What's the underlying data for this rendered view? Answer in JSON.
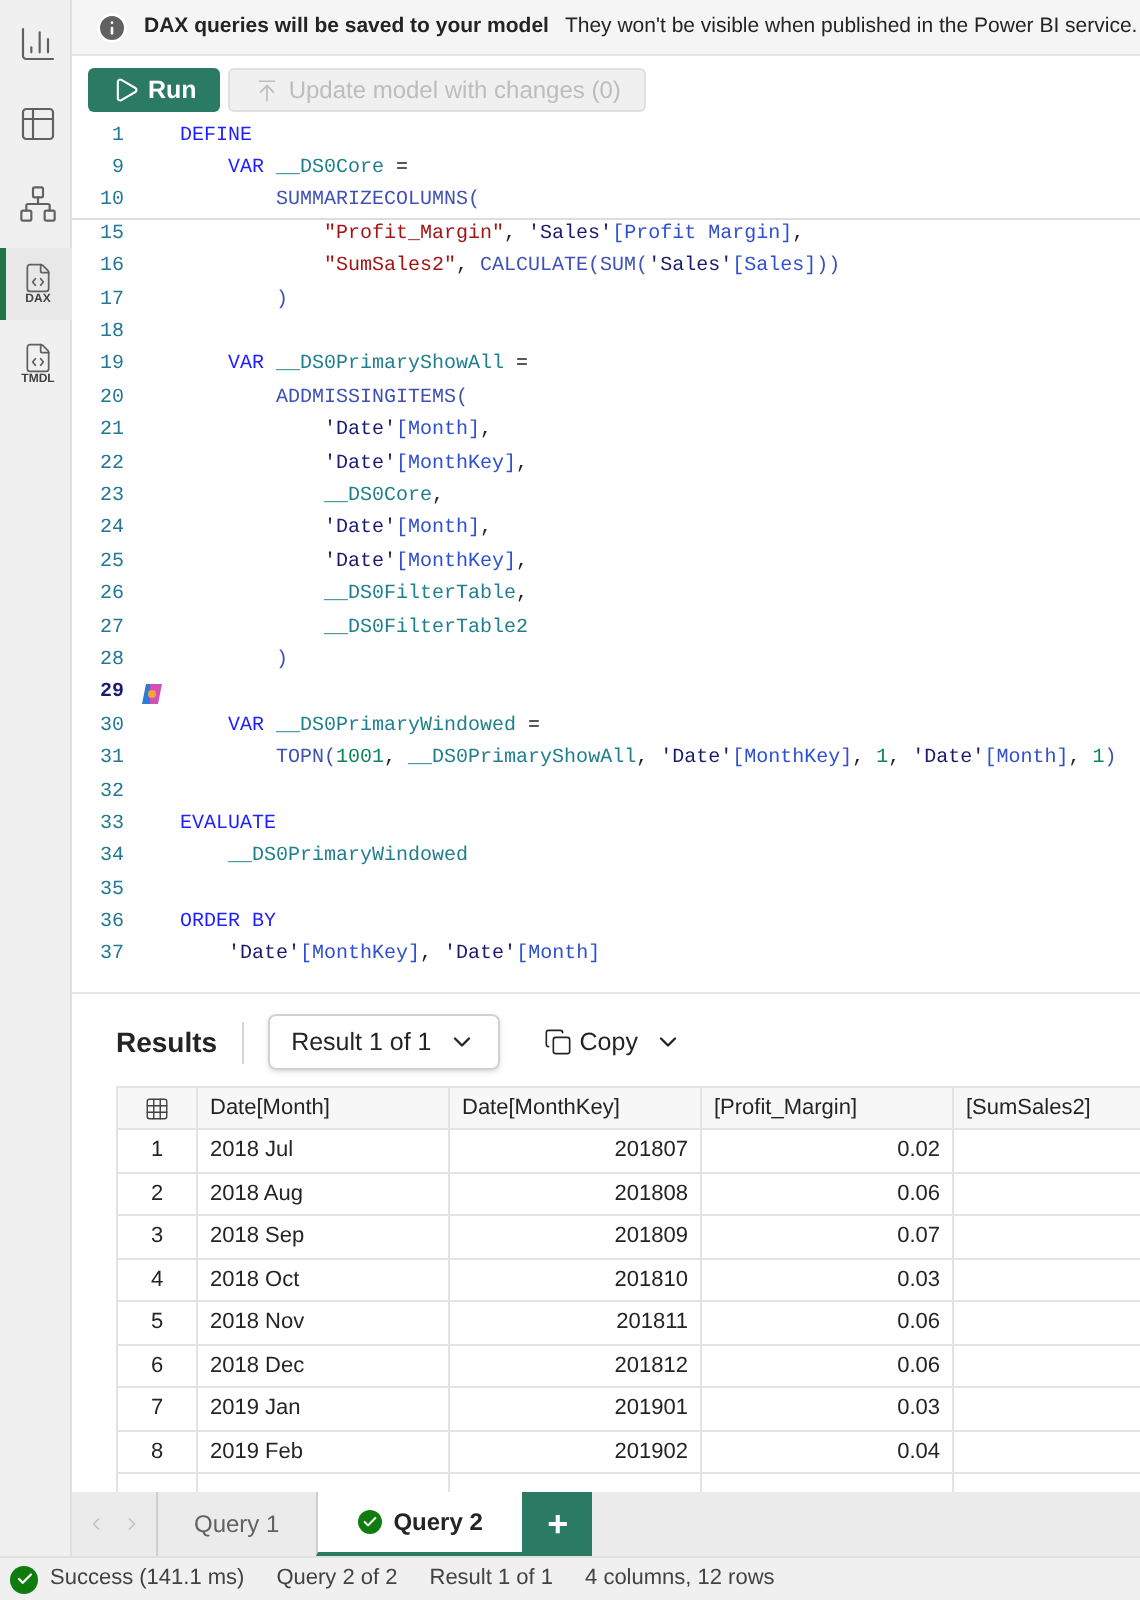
{
  "sidebar": {
    "items": [
      {
        "kind": "report",
        "selected": false
      },
      {
        "kind": "table",
        "selected": false
      },
      {
        "kind": "model",
        "selected": false
      },
      {
        "kind": "dax",
        "label": "DAX",
        "selected": true
      },
      {
        "kind": "tmdl",
        "label": "TMDL",
        "selected": false
      }
    ]
  },
  "banner": {
    "title": "DAX queries will be saved to your model",
    "message": "They won't be visible when published in the Power BI service."
  },
  "toolbar": {
    "run": "Run",
    "update": "Update model with changes (0)",
    "update_disabled": true
  },
  "editor": {
    "lines": [
      {
        "number": "1",
        "current": false,
        "tokens": [
          {
            "kind": "keyword",
            "text": "DEFINE"
          }
        ]
      },
      {
        "number": "9",
        "current": false,
        "tokens": [
          {
            "kind": "keyword",
            "text": "    VAR"
          },
          {
            "kind": "variable",
            "text": " __DS0Core"
          },
          {
            "kind": "plain",
            "text": " ="
          }
        ]
      },
      {
        "number": "10",
        "current": false,
        "tokens": [
          {
            "kind": "function",
            "text": "        SUMMARIZECOLUMNS("
          }
        ]
      },
      {
        "number": "15",
        "current": false,
        "tokens": [
          {
            "kind": "string",
            "text": "            \"Profit_Margin\""
          },
          {
            "kind": "plain",
            "text": ","
          },
          {
            "kind": "table",
            "text": " 'Sales'"
          },
          {
            "kind": "column",
            "text": "[Profit Margin]"
          },
          {
            "kind": "plain",
            "text": ","
          }
        ]
      },
      {
        "number": "16",
        "current": false,
        "tokens": [
          {
            "kind": "string",
            "text": "            \"SumSales2\""
          },
          {
            "kind": "plain",
            "text": ","
          },
          {
            "kind": "function",
            "text": " CALCULATE(SUM("
          },
          {
            "kind": "table",
            "text": "'Sales'"
          },
          {
            "kind": "column",
            "text": "[Sales]"
          },
          {
            "kind": "function",
            "text": "))"
          }
        ]
      },
      {
        "number": "17",
        "current": false,
        "tokens": [
          {
            "kind": "function",
            "text": "        )"
          }
        ]
      },
      {
        "number": "18",
        "current": false
      },
      {
        "number": "19",
        "current": false,
        "tokens": [
          {
            "kind": "keyword",
            "text": "    VAR"
          },
          {
            "kind": "variable",
            "text": " __DS0PrimaryShowAll"
          },
          {
            "kind": "plain",
            "text": " ="
          }
        ]
      },
      {
        "number": "20",
        "current": false,
        "tokens": [
          {
            "kind": "function",
            "text": "        ADDMISSINGITEMS("
          }
        ]
      },
      {
        "number": "21",
        "current": false,
        "tokens": [
          {
            "kind": "table",
            "text": "            'Date'"
          },
          {
            "kind": "column",
            "text": "[Month]"
          },
          {
            "kind": "plain",
            "text": ","
          }
        ]
      },
      {
        "number": "22",
        "current": false,
        "tokens": [
          {
            "kind": "table",
            "text": "            'Date'"
          },
          {
            "kind": "column",
            "text": "[MonthKey]"
          },
          {
            "kind": "plain",
            "text": ","
          }
        ]
      },
      {
        "number": "23",
        "current": false,
        "tokens": [
          {
            "kind": "variable",
            "text": "            __DS0Core"
          },
          {
            "kind": "plain",
            "text": ","
          }
        ]
      },
      {
        "number": "24",
        "current": false,
        "tokens": [
          {
            "kind": "table",
            "text": "            'Date'"
          },
          {
            "kind": "column",
            "text": "[Month]"
          },
          {
            "kind": "plain",
            "text": ","
          }
        ]
      },
      {
        "number": "25",
        "current": false,
        "tokens": [
          {
            "kind": "table",
            "text": "            'Date'"
          },
          {
            "kind": "column",
            "text": "[MonthKey]"
          },
          {
            "kind": "plain",
            "text": ","
          }
        ]
      },
      {
        "number": "26",
        "current": false,
        "tokens": [
          {
            "kind": "variable",
            "text": "            __DS0FilterTable"
          },
          {
            "kind": "plain",
            "text": ","
          }
        ]
      },
      {
        "number": "27",
        "current": false,
        "tokens": [
          {
            "kind": "variable",
            "text": "            __DS0FilterTable2"
          }
        ]
      },
      {
        "number": "28",
        "current": false,
        "tokens": [
          {
            "kind": "function",
            "text": "        )"
          }
        ]
      },
      {
        "number": "29",
        "current": true
      },
      {
        "number": "30",
        "current": false,
        "tokens": [
          {
            "kind": "keyword",
            "text": "    VAR"
          },
          {
            "kind": "variable",
            "text": " __DS0PrimaryWindowed"
          },
          {
            "kind": "plain",
            "text": " ="
          }
        ]
      },
      {
        "number": "31",
        "current": false,
        "tokens": [
          {
            "kind": "function",
            "text": "        TOPN("
          },
          {
            "kind": "number",
            "text": "1001"
          },
          {
            "kind": "plain",
            "text": ","
          },
          {
            "kind": "variable",
            "text": " __DS0PrimaryShowAll"
          },
          {
            "kind": "plain",
            "text": ","
          },
          {
            "kind": "table",
            "text": " 'Date'"
          },
          {
            "kind": "column",
            "text": "[MonthKey]"
          },
          {
            "kind": "plain",
            "text": ","
          },
          {
            "kind": "number",
            "text": " 1"
          },
          {
            "kind": "plain",
            "text": ","
          },
          {
            "kind": "table",
            "text": " 'Date'"
          },
          {
            "kind": "column",
            "text": "[Month]"
          },
          {
            "kind": "plain",
            "text": ","
          },
          {
            "kind": "number",
            "text": " 1"
          },
          {
            "kind": "function",
            "text": ")"
          }
        ]
      },
      {
        "number": "32",
        "current": false
      },
      {
        "number": "33",
        "current": false,
        "tokens": [
          {
            "kind": "keyword",
            "text": "EVALUATE"
          }
        ]
      },
      {
        "number": "34",
        "current": false,
        "tokens": [
          {
            "kind": "variable",
            "text": "    __DS0PrimaryWindowed"
          }
        ]
      },
      {
        "number": "35",
        "current": false
      },
      {
        "number": "36",
        "current": false,
        "tokens": [
          {
            "kind": "keyword",
            "text": "ORDER BY"
          }
        ]
      },
      {
        "number": "37",
        "current": false,
        "tokens": [
          {
            "kind": "table",
            "text": "    'Date'"
          },
          {
            "kind": "column",
            "text": "[MonthKey]"
          },
          {
            "kind": "plain",
            "text": ","
          },
          {
            "kind": "table",
            "text": " 'Date'"
          },
          {
            "kind": "column",
            "text": "[Month]"
          }
        ]
      }
    ]
  },
  "results": {
    "title": "Results",
    "result_picker": "Result 1 of 1",
    "copy": "Copy",
    "table": {
      "columns": [
        "Date[Month]",
        "Date[MonthKey]",
        "[Profit_Margin]",
        "[SumSales2]"
      ],
      "rows": [
        {
          "index": "1",
          "cells": [
            "2018 Jul",
            "201807",
            "0.02"
          ]
        },
        {
          "index": "2",
          "cells": [
            "2018 Aug",
            "201808",
            "0.06"
          ]
        },
        {
          "index": "3",
          "cells": [
            "2018 Sep",
            "201809",
            "0.07"
          ]
        },
        {
          "index": "4",
          "cells": [
            "2018 Oct",
            "201810",
            "0.03"
          ]
        },
        {
          "index": "5",
          "cells": [
            "2018 Nov",
            "201811",
            "0.06"
          ]
        },
        {
          "index": "6",
          "cells": [
            "2018 Dec",
            "201812",
            "0.06"
          ]
        },
        {
          "index": "7",
          "cells": [
            "2019 Jan",
            "201901",
            "0.03"
          ]
        },
        {
          "index": "8",
          "cells": [
            "2019 Feb",
            "201902",
            "0.04"
          ]
        }
      ]
    }
  },
  "query_tabs": [
    {
      "label": "Query 1",
      "selected": false,
      "success": false
    },
    {
      "label": "Query 2",
      "selected": true,
      "success": true
    }
  ],
  "new_tab": "+",
  "status_bar": {
    "status": "Success (141.1 ms)",
    "items": [
      "Query 2 of 2",
      "Result 1 of 1",
      "4 columns, 12 rows"
    ]
  }
}
